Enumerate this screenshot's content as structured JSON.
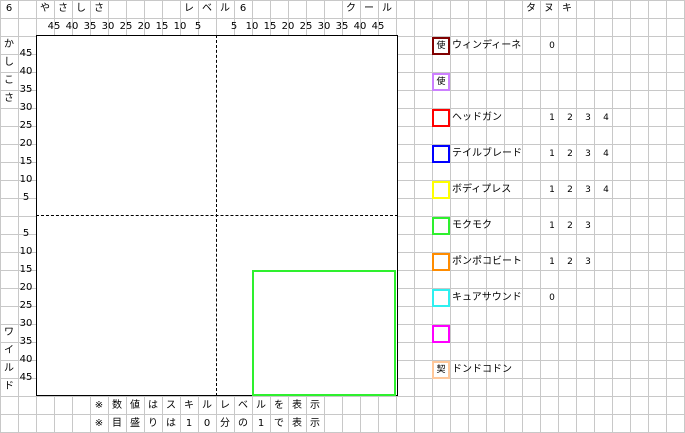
{
  "header": {
    "left_value": "6",
    "easy_label": [
      "や",
      "さ",
      "し",
      "さ"
    ],
    "level_label": [
      "レ",
      "ベ",
      "ル"
    ],
    "level_value": "6",
    "cool_label": [
      "ク",
      "ー",
      "ル"
    ],
    "col_tanuki": [
      "タ",
      "ヌ",
      "キ"
    ]
  },
  "x_ticks_left": [
    "45",
    "40",
    "35",
    "30",
    "25",
    "20",
    "15",
    "10",
    "5"
  ],
  "x_ticks_right": [
    "5",
    "10",
    "15",
    "20",
    "25",
    "30",
    "35",
    "40",
    "45"
  ],
  "y_label_top": [
    "か",
    "し",
    "こ",
    "さ"
  ],
  "y_label_bottom": [
    "ワ",
    "イ",
    "ル",
    "ド"
  ],
  "y_ticks_top": [
    "45",
    "40",
    "35",
    "30",
    "25",
    "20",
    "15",
    "10",
    "5"
  ],
  "y_ticks_bottom": [
    "5",
    "10",
    "15",
    "20",
    "25",
    "30",
    "35",
    "40",
    "45"
  ],
  "notes": {
    "line1": [
      "※",
      "数",
      "値",
      "は",
      "ス",
      "キ",
      "ル",
      "レ",
      "ベ",
      "ル",
      "を",
      "表",
      "示"
    ],
    "line2": [
      "※",
      "目",
      "盛",
      "り",
      "は",
      "1",
      "0",
      "分",
      "の",
      "1",
      "で",
      "表",
      "示"
    ]
  },
  "legend": [
    {
      "color": "#800000",
      "mark": "使",
      "label": "ウィンディーネ",
      "values": [
        "0"
      ]
    },
    {
      "color": "#cc80ff",
      "mark": "使",
      "label": "",
      "values": []
    },
    {
      "color": "#ff0000",
      "mark": "",
      "label": "ヘッドガン",
      "values": [
        "1",
        "2",
        "3",
        "4"
      ]
    },
    {
      "color": "#0000ff",
      "mark": "",
      "label": "テイルブレード",
      "values": [
        "1",
        "2",
        "3",
        "4"
      ]
    },
    {
      "color": "#ffff00",
      "mark": "",
      "label": "ボディプレス",
      "values": [
        "1",
        "2",
        "3",
        "4"
      ]
    },
    {
      "color": "#2ef02e",
      "mark": "",
      "label": "モクモク",
      "values": [
        "1",
        "2",
        "3"
      ]
    },
    {
      "color": "#ff8c00",
      "mark": "",
      "label": "ポンポコビート",
      "values": [
        "1",
        "2",
        "3"
      ]
    },
    {
      "color": "#2ef0f0",
      "mark": "",
      "label": "キュアサウンド",
      "values": [
        "0"
      ]
    },
    {
      "color": "#ff00ff",
      "mark": "",
      "label": "",
      "values": []
    },
    {
      "color": "#ffc89b",
      "mark": "契",
      "label": "ドンドコドン",
      "values": []
    }
  ],
  "chart_data": {
    "type": "area",
    "x_axis": {
      "left_label": "やさしさ",
      "right_label": "クール",
      "range": [
        -50,
        50
      ]
    },
    "y_axis": {
      "top_label": "かしこさ",
      "bottom_label": "ワイルド",
      "range": [
        -50,
        50
      ]
    },
    "regions": [
      {
        "name": "モクモク",
        "color": "#2ef02e",
        "x": [
          10,
          50
        ],
        "y": [
          -15,
          -50
        ]
      }
    ]
  }
}
